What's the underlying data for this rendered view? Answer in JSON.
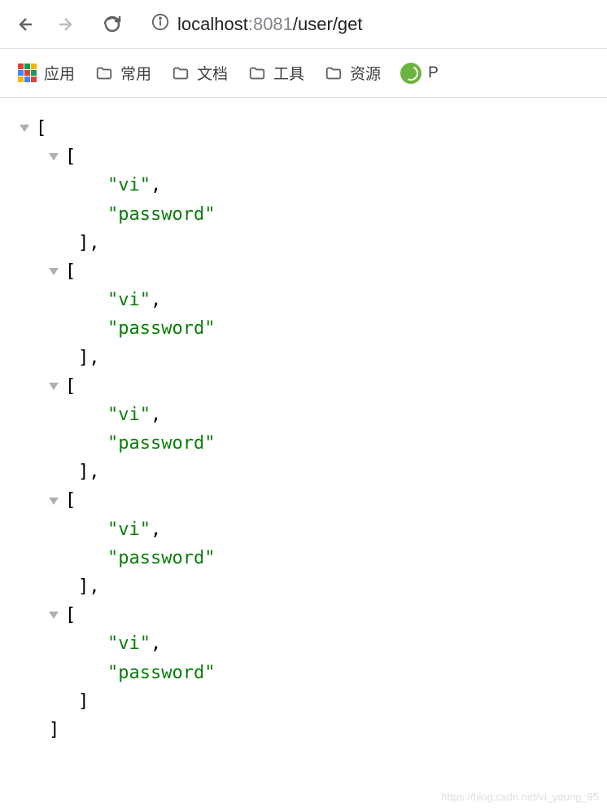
{
  "nav": {
    "url_host": "localhost",
    "url_port": ":8081",
    "url_path": "/user/get"
  },
  "bookmarks": {
    "apps_label": "应用",
    "items": [
      {
        "label": "常用"
      },
      {
        "label": "文档"
      },
      {
        "label": "工具"
      },
      {
        "label": "资源"
      }
    ],
    "spring_label": "P"
  },
  "json_data": {
    "arrays": [
      [
        "vi",
        "password"
      ],
      [
        "vi",
        "password"
      ],
      [
        "vi",
        "password"
      ],
      [
        "vi",
        "password"
      ],
      [
        "vi",
        "password"
      ]
    ]
  },
  "watermark": "https://blog.csdn.net/vi_young_95"
}
